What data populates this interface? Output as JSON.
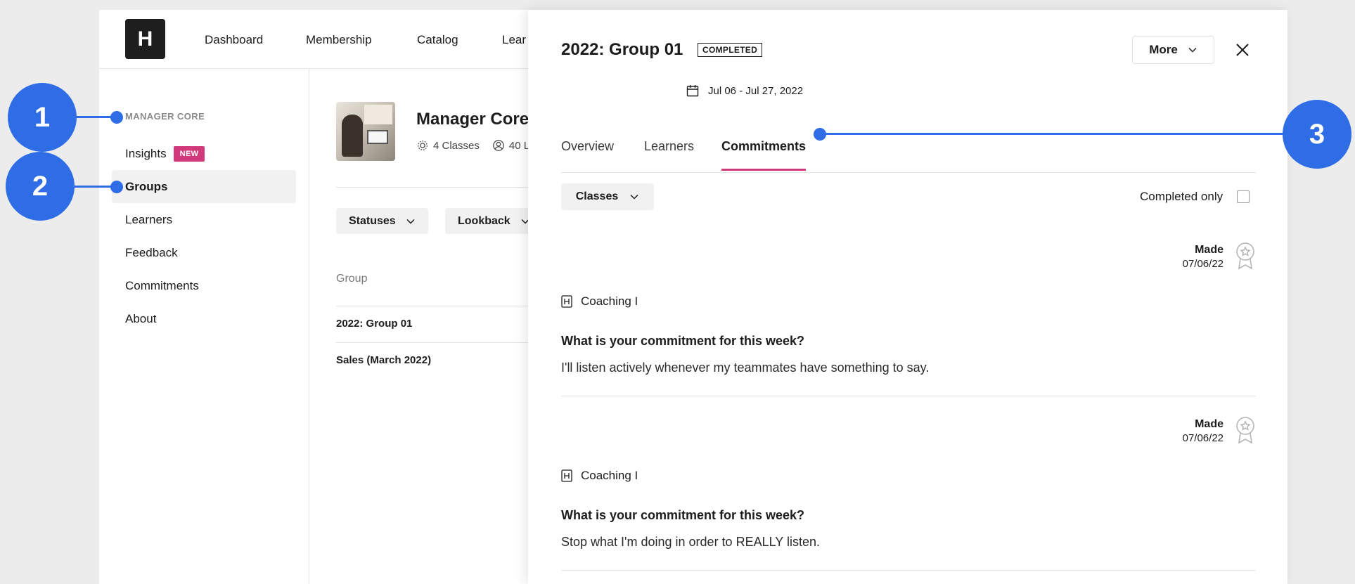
{
  "nav": {
    "logo_letter": "H",
    "links": [
      "Dashboard",
      "Membership",
      "Catalog",
      "Lear"
    ]
  },
  "sidebar": {
    "section": "MANAGER CORE",
    "items": [
      {
        "label": "Insights",
        "badge": "NEW"
      },
      {
        "label": "Groups"
      },
      {
        "label": "Learners"
      },
      {
        "label": "Feedback"
      },
      {
        "label": "Commitments"
      },
      {
        "label": "About"
      }
    ]
  },
  "main": {
    "title": "Manager Core",
    "classes": "4 Classes",
    "learners": "40 L",
    "filters": [
      "Statuses",
      "Lookback"
    ],
    "table": {
      "header": "Group",
      "rows": [
        "2022: Group 01",
        "Sales (March 2022)"
      ]
    }
  },
  "drawer": {
    "title": "2022: Group 01",
    "status": "COMPLETED",
    "more_label": "More",
    "date_range": "Jul 06 - Jul 27, 2022",
    "tabs": [
      "Overview",
      "Learners",
      "Commitments"
    ],
    "active_tab": "Commitments",
    "classes_filter": "Classes",
    "completed_only": "Completed only",
    "commitments": [
      {
        "made_label": "Made",
        "made_date": "07/06/22",
        "class_name": "Coaching I",
        "question": "What is your commitment for this week?",
        "answer": "I'll listen actively whenever my teammates have something to say."
      },
      {
        "made_label": "Made",
        "made_date": "07/06/22",
        "class_name": "Coaching I",
        "question": "What is your commitment for this week?",
        "answer": "Stop what I'm doing in order to REALLY listen."
      }
    ]
  },
  "callouts": [
    "1",
    "2",
    "3"
  ],
  "colors": {
    "accent_pink": "#d13a7a",
    "callout_blue": "#2f6de7"
  }
}
